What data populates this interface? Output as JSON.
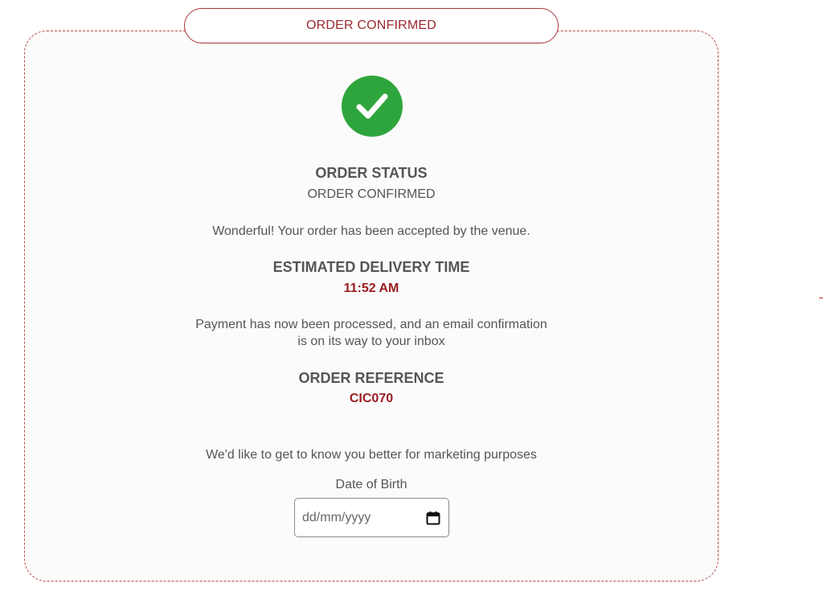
{
  "header": {
    "title": "ORDER CONFIRMED"
  },
  "status": {
    "icon": "check-circle-icon",
    "heading": "ORDER STATUS",
    "value": "ORDER CONFIRMED",
    "message": "Wonderful! Your order has been accepted by the venue."
  },
  "delivery": {
    "heading": "ESTIMATED DELIVERY TIME",
    "time": "11:52 AM"
  },
  "payment": {
    "line1": "Payment has now been processed, and an email confirmation",
    "line2": "is on its way to your inbox"
  },
  "reference": {
    "heading": "ORDER REFERENCE",
    "value": "CIC070"
  },
  "marketing": {
    "intro": "We'd like to get to know you better for marketing purposes",
    "dob_label": "Date of Birth",
    "dob_placeholder": "dd/mm/yyyy",
    "dob_icon": "calendar-icon"
  },
  "colors": {
    "accent": "#9b1c22",
    "success": "#2ea53c",
    "text": "#555555",
    "border": "#b84a4a"
  }
}
